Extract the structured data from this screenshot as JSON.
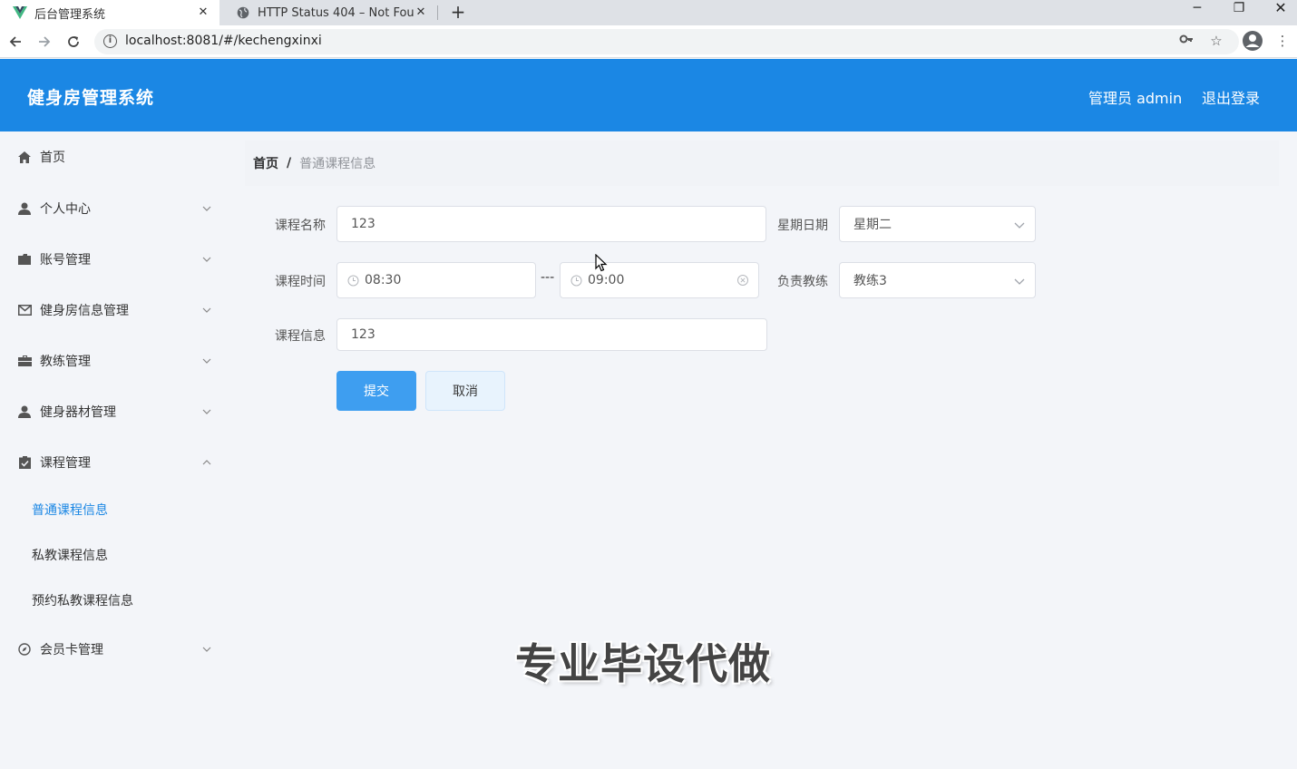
{
  "browser": {
    "tabs": [
      {
        "title": "后台管理系统",
        "active": true,
        "favicon": "vue-logo-icon"
      },
      {
        "title": "HTTP Status 404 – Not Found",
        "active": false,
        "favicon": "globe-icon"
      }
    ],
    "url": "localhost:8081/#/kechengxinxi"
  },
  "header": {
    "title": "健身房管理系统",
    "user": "管理员 admin",
    "logout": "退出登录",
    "color": "#1b87e4"
  },
  "sidebar": {
    "items": [
      {
        "label": "首页",
        "icon": "home-icon",
        "arrow": "none"
      },
      {
        "label": "个人中心",
        "icon": "user-icon",
        "arrow": "down"
      },
      {
        "label": "账号管理",
        "icon": "folder-icon",
        "arrow": "down"
      },
      {
        "label": "健身房信息管理",
        "icon": "mail-icon",
        "arrow": "down"
      },
      {
        "label": "教练管理",
        "icon": "briefcase-icon",
        "arrow": "down"
      },
      {
        "label": "健身器材管理",
        "icon": "user-icon",
        "arrow": "down"
      },
      {
        "label": "课程管理",
        "icon": "clipboard-icon",
        "arrow": "up"
      },
      {
        "label": "会员卡管理",
        "icon": "compass-icon",
        "arrow": "down"
      }
    ],
    "subitems": [
      {
        "label": "普通课程信息",
        "active": true
      },
      {
        "label": "私教课程信息",
        "active": false
      },
      {
        "label": "预约私教课程信息",
        "active": false
      }
    ]
  },
  "breadcrumb": {
    "home": "首页",
    "separator": "/",
    "current": "普通课程信息"
  },
  "form": {
    "course_name_label": "课程名称",
    "course_name_value": "123",
    "weekday_label": "星期日期",
    "weekday_value": "星期二",
    "time_label": "课程时间",
    "time_start": "08:30",
    "time_separator": "---",
    "time_end": "09:00",
    "coach_label": "负责教练",
    "coach_value": "教练3",
    "info_label": "课程信息",
    "info_value": "123",
    "submit_label": "提交",
    "cancel_label": "取消"
  },
  "watermark": "专业毕设代做"
}
